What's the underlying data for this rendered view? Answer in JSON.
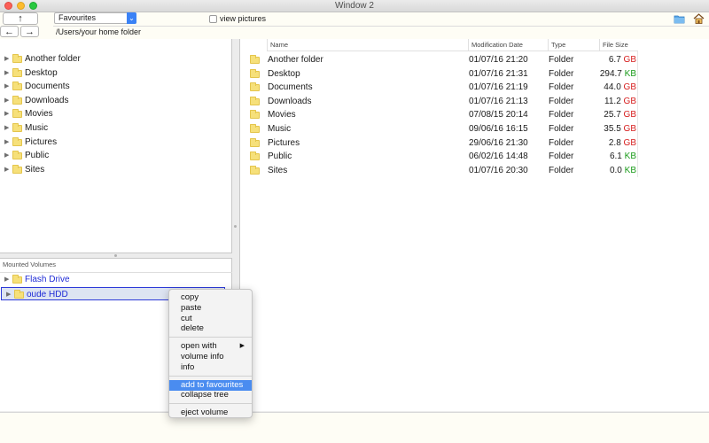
{
  "window": {
    "title": "Window 2"
  },
  "toolbar": {
    "up_label": "↑",
    "back_label": "←",
    "forward_label": "→",
    "location_select": "Favourites",
    "view_pictures_label": "view pictures",
    "view_pictures_checked": false,
    "path": "/Users/your home folder"
  },
  "sidebar": {
    "folders": [
      "Another folder",
      "Desktop",
      "Documents",
      "Downloads",
      "Movies",
      "Music",
      "Pictures",
      "Public",
      "Sites"
    ],
    "volumes_header": "Mounted Volumes",
    "volumes": [
      {
        "label": "Flash Drive",
        "selected": false
      },
      {
        "label": "oude HDD",
        "selected": true
      }
    ]
  },
  "file_list": {
    "columns": [
      "Name",
      "Modification Date",
      "Type",
      "File Size"
    ],
    "rows": [
      {
        "name": "Another folder",
        "date": "01/07/16 21:20",
        "type": "Folder",
        "size": "6.7",
        "unit": "GB"
      },
      {
        "name": "Desktop",
        "date": "01/07/16 21:31",
        "type": "Folder",
        "size": "294.7",
        "unit": "KB"
      },
      {
        "name": "Documents",
        "date": "01/07/16 21:19",
        "type": "Folder",
        "size": "44.0",
        "unit": "GB"
      },
      {
        "name": "Downloads",
        "date": "01/07/16 21:13",
        "type": "Folder",
        "size": "11.2",
        "unit": "GB"
      },
      {
        "name": "Movies",
        "date": "07/08/15 20:14",
        "type": "Folder",
        "size": "25.7",
        "unit": "GB"
      },
      {
        "name": "Music",
        "date": "09/06/16 16:15",
        "type": "Folder",
        "size": "35.5",
        "unit": "GB"
      },
      {
        "name": "Pictures",
        "date": "29/06/16 21:30",
        "type": "Folder",
        "size": "2.8",
        "unit": "GB"
      },
      {
        "name": "Public",
        "date": "06/02/16 14:48",
        "type": "Folder",
        "size": "6.1",
        "unit": "KB"
      },
      {
        "name": "Sites",
        "date": "01/07/16 20:30",
        "type": "Folder",
        "size": "0.0",
        "unit": "KB"
      }
    ]
  },
  "context_menu": {
    "groups": [
      [
        "copy",
        "paste",
        "cut",
        "delete"
      ],
      [
        "open with",
        "volume info",
        "info"
      ],
      [
        "add to favourites",
        "collapse tree"
      ],
      [
        "eject volume"
      ]
    ],
    "highlighted": "add to favourites",
    "submenu_item": "open with"
  },
  "colors": {
    "gb": "#d61c1c",
    "kb": "#1a9b1a",
    "volume_link": "#1f2bd6",
    "highlight": "#4a8cf0"
  },
  "icons": {
    "folder_toolbar": "folder-icon",
    "home_toolbar": "home-icon",
    "folder": "folder-icon",
    "disclosure": "disclosure-triangle-icon"
  }
}
